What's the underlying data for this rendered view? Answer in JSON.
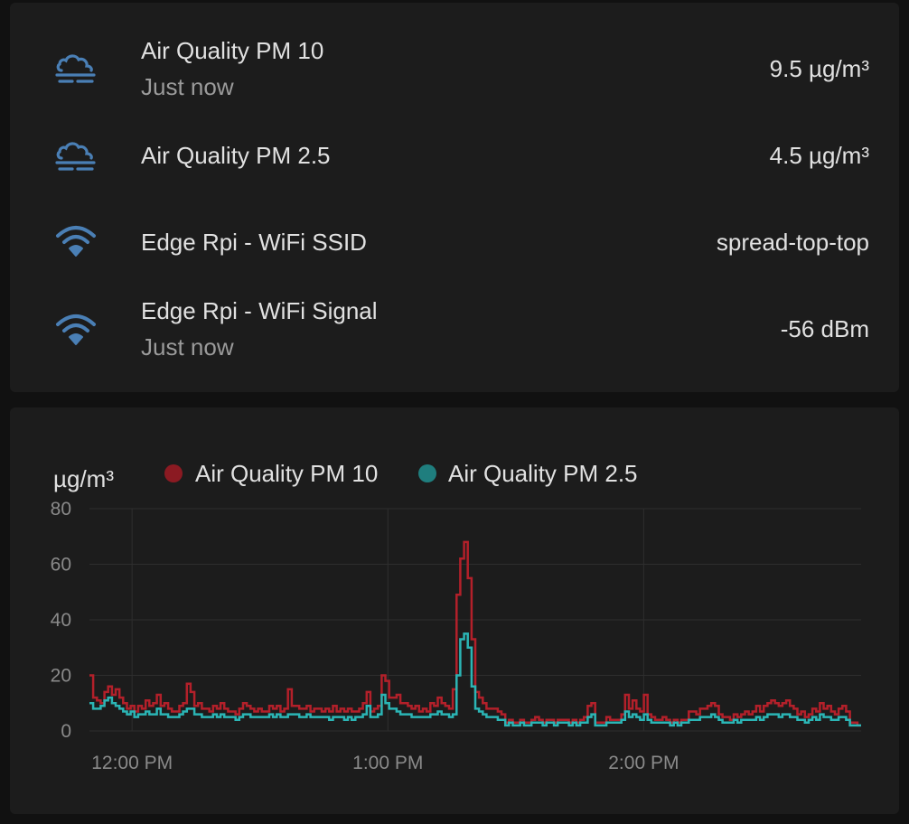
{
  "colors": {
    "background": "#111111",
    "card": "#1c1c1c",
    "icon": "#4a7fb5",
    "pm10": "#b3202a",
    "pm25": "#2bb5b5"
  },
  "entities": [
    {
      "name": "Air Quality PM 10",
      "secondary": "Just now",
      "value": "9.5 µg/m³",
      "icon": "weather-fog-icon"
    },
    {
      "name": "Air Quality PM 2.5",
      "secondary": "",
      "value": "4.5 µg/m³",
      "icon": "weather-fog-icon"
    },
    {
      "name": "Edge Rpi - WiFi SSID",
      "secondary": "",
      "value": "spread-top-top",
      "icon": "wifi-icon"
    },
    {
      "name": "Edge Rpi - WiFi Signal",
      "secondary": "Just now",
      "value": "-56 dBm",
      "icon": "wifi-icon"
    }
  ],
  "chart_data": {
    "type": "line",
    "step": true,
    "ylabel": "µg/m³",
    "ylim": [
      0,
      80
    ],
    "yticks": [
      "0",
      "20",
      "40",
      "60",
      "80"
    ],
    "xlim_minutes": [
      -10,
      171
    ],
    "xticks": [
      {
        "label": "12:00 PM",
        "minute": 0
      },
      {
        "label": "1:00 PM",
        "minute": 60
      },
      {
        "label": "2:00 PM",
        "minute": 120
      }
    ],
    "grid": true,
    "legend_position": "top",
    "series": [
      {
        "name": "Air Quality PM 10",
        "color": "#b3202a",
        "values": [
          20,
          12,
          11,
          10,
          14,
          16,
          13,
          15,
          12,
          10,
          8,
          9,
          7,
          9,
          8,
          11,
          9,
          10,
          13,
          9,
          10,
          8,
          7,
          7,
          9,
          10,
          17,
          14,
          9,
          10,
          8,
          8,
          7,
          9,
          8,
          10,
          8,
          7,
          7,
          6,
          8,
          10,
          9,
          8,
          7,
          8,
          7,
          7,
          9,
          8,
          9,
          7,
          8,
          15,
          9,
          9,
          8,
          8,
          9,
          7,
          8,
          8,
          7,
          8,
          7,
          9,
          7,
          8,
          7,
          8,
          7,
          7,
          8,
          10,
          14,
          7,
          8,
          9,
          20,
          18,
          12,
          12,
          13,
          10,
          10,
          9,
          8,
          9,
          7,
          8,
          7,
          10,
          9,
          12,
          10,
          9,
          8,
          15,
          49,
          62,
          68,
          55,
          33,
          14,
          12,
          10,
          8,
          8,
          8,
          7,
          6,
          3,
          4,
          3,
          3,
          4,
          3,
          3,
          4,
          5,
          4,
          3,
          4,
          4,
          3,
          4,
          4,
          4,
          3,
          4,
          3,
          4,
          5,
          9,
          10,
          3,
          3,
          3,
          5,
          4,
          4,
          4,
          6,
          13,
          8,
          11,
          8,
          7,
          13,
          6,
          5,
          4,
          4,
          5,
          4,
          3,
          4,
          3,
          4,
          4,
          7,
          7,
          6,
          8,
          8,
          9,
          10,
          9,
          6,
          5,
          5,
          4,
          6,
          5,
          6,
          7,
          6,
          7,
          9,
          7,
          9,
          10,
          11,
          10,
          9,
          10,
          11,
          9,
          8,
          6,
          7,
          5,
          6,
          8,
          7,
          10,
          8,
          9,
          7,
          6,
          8,
          9,
          7,
          3,
          3,
          2
        ],
        "latest_value": 9.5
      },
      {
        "name": "Air Quality PM 2.5",
        "color": "#2bb5b5",
        "values": [
          10,
          8,
          8,
          9,
          11,
          12,
          10,
          9,
          8,
          7,
          6,
          7,
          5,
          6,
          6,
          7,
          6,
          6,
          8,
          6,
          6,
          5,
          5,
          5,
          6,
          7,
          8,
          8,
          6,
          6,
          5,
          5,
          5,
          6,
          5,
          6,
          5,
          5,
          5,
          4,
          5,
          6,
          6,
          5,
          5,
          5,
          5,
          5,
          6,
          5,
          6,
          5,
          5,
          6,
          6,
          6,
          5,
          5,
          6,
          5,
          5,
          5,
          5,
          5,
          4,
          5,
          5,
          5,
          4,
          5,
          4,
          5,
          5,
          6,
          9,
          5,
          5,
          6,
          13,
          10,
          8,
          8,
          7,
          6,
          6,
          6,
          5,
          5,
          5,
          5,
          5,
          6,
          6,
          7,
          6,
          6,
          5,
          6,
          20,
          33,
          35,
          30,
          16,
          8,
          7,
          6,
          5,
          5,
          5,
          4,
          4,
          2,
          3,
          2,
          2,
          3,
          2,
          2,
          3,
          3,
          3,
          2,
          3,
          3,
          2,
          3,
          3,
          3,
          2,
          3,
          2,
          3,
          3,
          5,
          6,
          2,
          2,
          2,
          3,
          3,
          3,
          3,
          4,
          7,
          5,
          6,
          5,
          4,
          6,
          4,
          3,
          3,
          3,
          3,
          3,
          2,
          3,
          2,
          3,
          3,
          4,
          4,
          4,
          5,
          5,
          5,
          6,
          5,
          4,
          3,
          3,
          3,
          4,
          3,
          4,
          4,
          4,
          4,
          5,
          4,
          5,
          6,
          6,
          6,
          5,
          6,
          6,
          5,
          5,
          4,
          4,
          3,
          4,
          5,
          4,
          6,
          5,
          5,
          4,
          4,
          5,
          5,
          4,
          2,
          2,
          2
        ],
        "latest_value": 4.5
      }
    ]
  }
}
